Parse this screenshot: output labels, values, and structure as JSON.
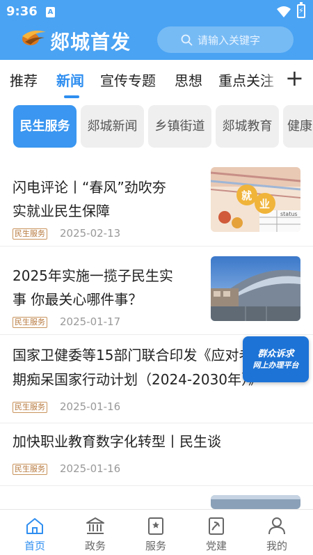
{
  "status_bar": {
    "time": "9:36",
    "sim_label": "A"
  },
  "header": {
    "app_title": "郯城首发",
    "search_placeholder": "请输入关键字"
  },
  "tabs": [
    {
      "label": "推荐",
      "active": false
    },
    {
      "label": "新闻",
      "active": true
    },
    {
      "label": "宣传专题",
      "active": false
    },
    {
      "label": "思想",
      "active": false
    },
    {
      "label": "重点关注",
      "active": false
    }
  ],
  "chips": [
    {
      "label": "民生服务",
      "active": true
    },
    {
      "label": "郯城新闻",
      "active": false
    },
    {
      "label": "乡镇街道",
      "active": false
    },
    {
      "label": "郯城教育",
      "active": false
    },
    {
      "label": "健康",
      "active": false
    }
  ],
  "news": [
    {
      "title_line1": "闪电评论丨“春风”劲吹夯",
      "title_line2": "实就业民生保障",
      "tag": "民生服务",
      "date": "2025-02-13",
      "thumb_text_1": "就",
      "thumb_text_2": "业",
      "thumb_text_3": "status"
    },
    {
      "title_line1": "2025年实施一揽子民生实",
      "title_line2": "事  你最关心哪件事？",
      "tag": "民生服务",
      "date": "2025-01-17"
    },
    {
      "title_line1": "国家卫健委等15部门联合印发《应对老年",
      "title_line2": "期痴呆国家行动计划（2024-2030年）》",
      "tag": "民生服务",
      "date": "2025-01-16"
    },
    {
      "title_line1": "加快职业教育数字化转型丨民生谈",
      "tag": "民生服务",
      "date": "2025-01-16"
    },
    {
      "title_line1": "……………",
      "tag": "",
      "date": ""
    }
  ],
  "float_badge": {
    "line1": "群众诉求",
    "line2": "网上办理平台"
  },
  "bottom_nav": [
    {
      "label": "首页",
      "icon": "home-icon",
      "active": true
    },
    {
      "label": "政务",
      "icon": "government-icon",
      "active": false
    },
    {
      "label": "服务",
      "icon": "service-icon",
      "active": false
    },
    {
      "label": "党建",
      "icon": "party-icon",
      "active": false
    },
    {
      "label": "我的",
      "icon": "user-icon",
      "active": false
    }
  ],
  "colors": {
    "primary": "#4aa3f3",
    "accent": "#2e8ef0",
    "tag": "#b7793e",
    "badge": "#1d73d6"
  }
}
